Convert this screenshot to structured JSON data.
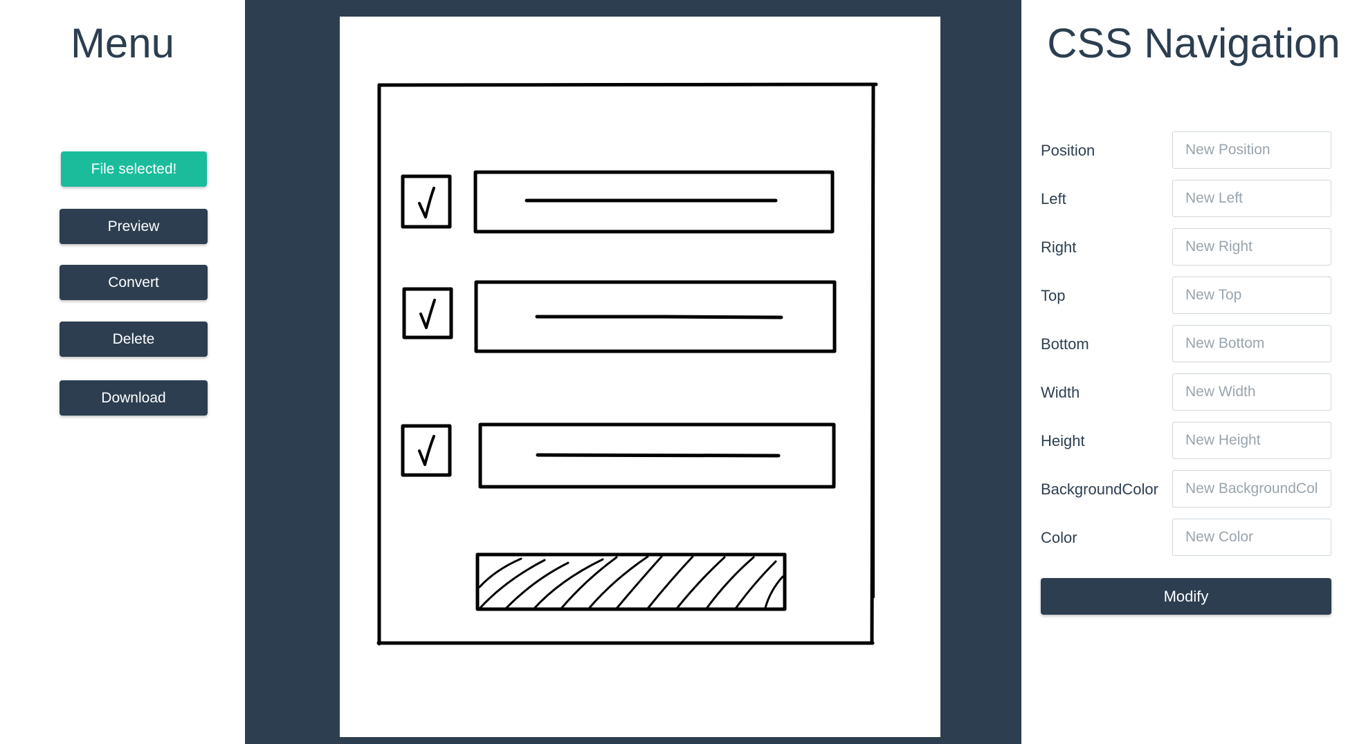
{
  "colors": {
    "primary": "#2c3e50",
    "accent": "#1abc9c",
    "canvas_bg": "#2c3e50"
  },
  "menu": {
    "title": "Menu",
    "file_button": "File selected!",
    "preview_button": "Preview",
    "convert_button": "Convert",
    "delete_button": "Delete",
    "download_button": "Download"
  },
  "css_nav": {
    "title": "CSS Navigation",
    "fields": [
      {
        "label": "Position",
        "placeholder": "New Position"
      },
      {
        "label": "Left",
        "placeholder": "New Left"
      },
      {
        "label": "Right",
        "placeholder": "New Right"
      },
      {
        "label": "Top",
        "placeholder": "New Top"
      },
      {
        "label": "Bottom",
        "placeholder": "New Bottom"
      },
      {
        "label": "Width",
        "placeholder": "New Width"
      },
      {
        "label": "Height",
        "placeholder": "New Height"
      },
      {
        "label": "BackgroundColor",
        "placeholder": "New BackgroundColor"
      },
      {
        "label": "Color",
        "placeholder": "New Color"
      }
    ],
    "modify_button": "Modify"
  },
  "sketch": {
    "description_icon": "hand-drawn-wireframe-image"
  }
}
